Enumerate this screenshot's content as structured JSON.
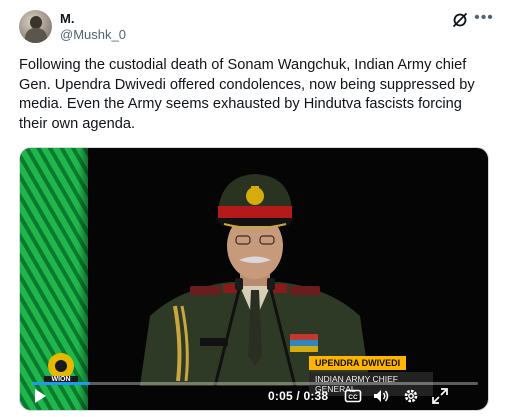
{
  "author": {
    "display_name": "M.",
    "handle": "@Mushk_0"
  },
  "post": {
    "text": "Following the custodial death of Sonam Wangchuk, Indian Army chief Gen. Upendra Dwivedi offered condolences, now being suppressed by media. Even the Army seems exhausted by Hindutva fascists forcing their own agenda."
  },
  "header_icons": [
    "grok-icon",
    "more-icon"
  ],
  "video": {
    "channel_logo": "WION",
    "lower_third_name": "UPENDRA DWIVEDI",
    "lower_third_title": "INDIAN ARMY CHIEF GENERAL",
    "current_time": "0:05",
    "separator": "/",
    "duration": "0:38",
    "progress": 0.13,
    "controls": [
      "play-icon",
      "captions-icon",
      "volume-icon",
      "settings-icon",
      "fullscreen-icon"
    ],
    "accent": "#1d9bf0"
  }
}
